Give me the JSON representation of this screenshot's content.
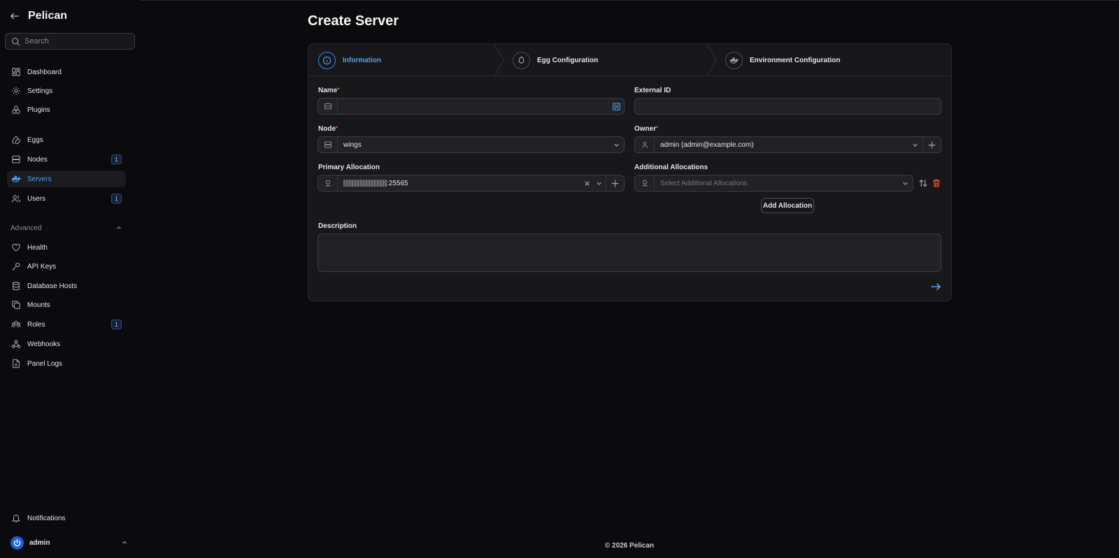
{
  "app": {
    "name": "Pelican"
  },
  "sidebar": {
    "search_placeholder": "Search",
    "items": [
      {
        "label": "Dashboard",
        "icon": "dashboard-icon"
      },
      {
        "label": "Settings",
        "icon": "gear-icon"
      },
      {
        "label": "Plugins",
        "icon": "plugins-icon"
      },
      {
        "label": "Eggs",
        "icon": "egg-icon"
      },
      {
        "label": "Nodes",
        "icon": "server-stack-icon",
        "badge": "1"
      },
      {
        "label": "Servers",
        "icon": "brand-docker-icon",
        "active": true
      },
      {
        "label": "Users",
        "icon": "users-icon",
        "badge": "1"
      }
    ],
    "advanced": {
      "label": "Advanced",
      "items": [
        {
          "label": "Health",
          "icon": "heart-icon"
        },
        {
          "label": "API Keys",
          "icon": "key-icon"
        },
        {
          "label": "Database Hosts",
          "icon": "database-icon"
        },
        {
          "label": "Mounts",
          "icon": "mounts-icon"
        },
        {
          "label": "Roles",
          "icon": "roles-icon",
          "badge": "1"
        },
        {
          "label": "Webhooks",
          "icon": "webhook-icon"
        },
        {
          "label": "Panel Logs",
          "icon": "file-icon"
        }
      ]
    },
    "notifications_label": "Notifications",
    "user_label": "admin"
  },
  "page": {
    "title": "Create Server",
    "steps": [
      {
        "label": "Information",
        "active": true
      },
      {
        "label": "Egg Configuration"
      },
      {
        "label": "Environment Configuration"
      }
    ],
    "fields": {
      "name": {
        "label": "Name",
        "required": "*",
        "value": ""
      },
      "external_id": {
        "label": "External ID",
        "value": ""
      },
      "node": {
        "label": "Node",
        "required": "*",
        "value": "wings"
      },
      "owner": {
        "label": "Owner",
        "required": "*",
        "value": "admin (admin@example.com)"
      },
      "primary_allocation": {
        "label": "Primary Allocation",
        "value": ":25565"
      },
      "additional_allocations": {
        "label": "Additional Allocations",
        "placeholder": "Select Additional Allocations"
      },
      "description": {
        "label": "Description",
        "value": ""
      }
    },
    "add_allocation_label": "Add Allocation"
  },
  "footer": {
    "text": "© 2026 Pelican"
  },
  "colors": {
    "accent": "#4ea1f3",
    "background": "#0b0b0d",
    "card": "#18181b",
    "danger": "#e4572e"
  }
}
